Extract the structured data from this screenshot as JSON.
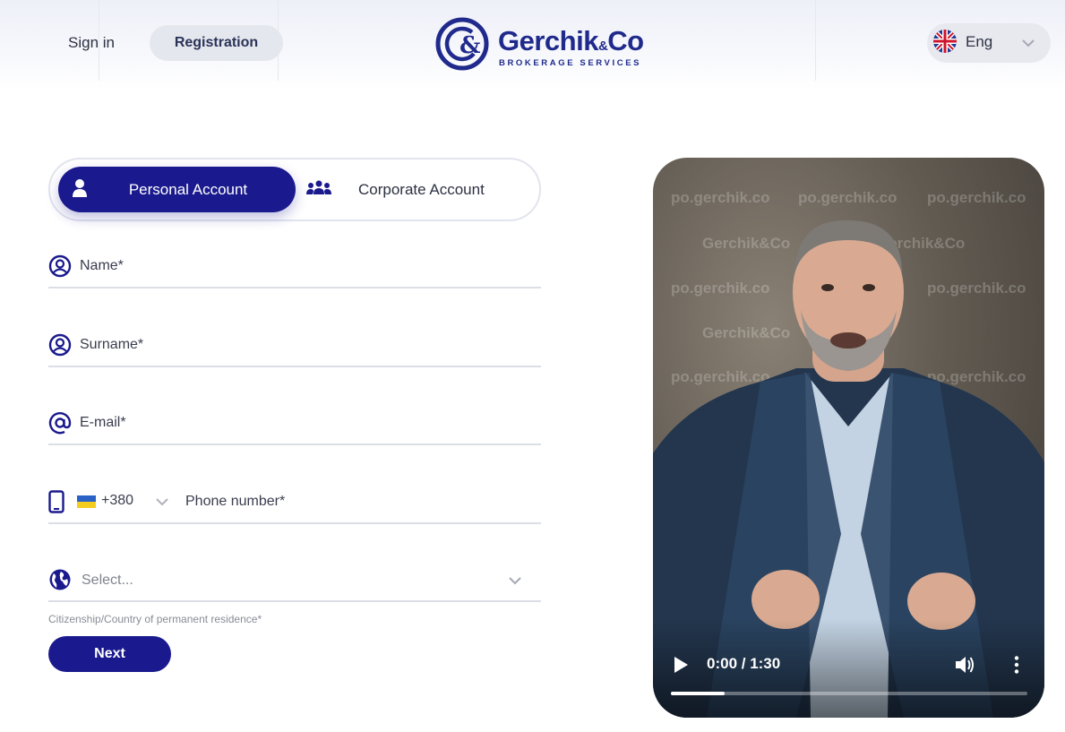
{
  "header": {
    "sign_in_label": "Sign in",
    "registration_label": "Registration",
    "logo": {
      "name": "Gerchik",
      "amp": "&",
      "co": "Co",
      "subtitle": "BROKERAGE SERVICES"
    },
    "language": {
      "label": "Eng",
      "flag_icon": "uk-flag-icon"
    }
  },
  "account_type": {
    "personal_label": "Personal Account",
    "corporate_label": "Corporate Account",
    "selected": "personal"
  },
  "form": {
    "name_placeholder": "Name*",
    "surname_placeholder": "Surname*",
    "email_placeholder": "E-mail*",
    "phone": {
      "country_code": "+380",
      "placeholder": "Phone number*",
      "flag_icon": "ukraine-flag-icon"
    },
    "citizenship": {
      "placeholder": "Select...",
      "hint": "Citizenship/Country of permanent residence*"
    },
    "next_label": "Next"
  },
  "video": {
    "time": "0:00 / 1:30",
    "progress": 0.15,
    "watermark_url": "po.gerchik.co",
    "watermark_brand": "Gerchik&Co"
  },
  "colors": {
    "primary": "#1a1a8e",
    "logo": "#1f2a8c",
    "pill_bg": "#e5e7ee"
  }
}
